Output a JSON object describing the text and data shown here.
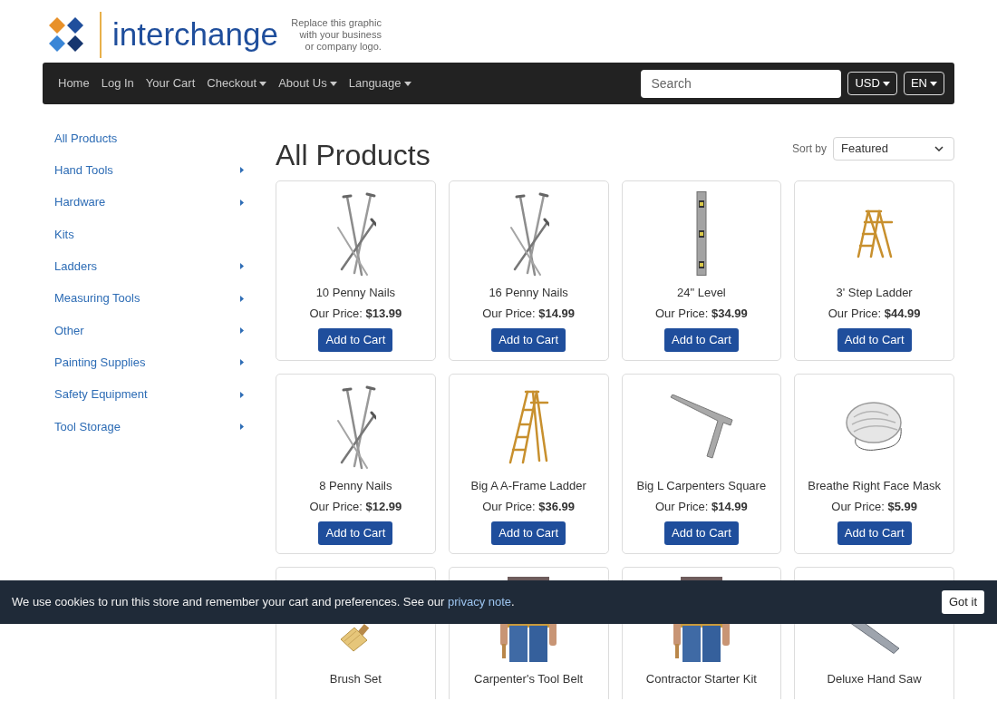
{
  "header": {
    "logo_text": "interchange",
    "tagline": "Replace this graphic with your business or company logo."
  },
  "nav": {
    "links": [
      {
        "label": "Home",
        "dropdown": false
      },
      {
        "label": "Log In",
        "dropdown": false
      },
      {
        "label": "Your Cart",
        "dropdown": false
      },
      {
        "label": "Checkout",
        "dropdown": true
      },
      {
        "label": "About Us",
        "dropdown": true
      },
      {
        "label": "Language",
        "dropdown": true
      }
    ],
    "search": {
      "placeholder": "Search"
    },
    "currency": "USD",
    "language": "EN"
  },
  "sidebar": {
    "items": [
      {
        "label": "All Products",
        "has_submenu": false
      },
      {
        "label": "Hand Tools",
        "has_submenu": true
      },
      {
        "label": "Hardware",
        "has_submenu": true
      },
      {
        "label": "Kits",
        "has_submenu": false
      },
      {
        "label": "Ladders",
        "has_submenu": true
      },
      {
        "label": "Measuring Tools",
        "has_submenu": true
      },
      {
        "label": "Other",
        "has_submenu": true
      },
      {
        "label": "Painting Supplies",
        "has_submenu": true
      },
      {
        "label": "Safety Equipment",
        "has_submenu": true
      },
      {
        "label": "Tool Storage",
        "has_submenu": true
      }
    ]
  },
  "main": {
    "title": "All Products",
    "sort": {
      "label": "Sort by",
      "value": "Featured"
    },
    "products": [
      {
        "kind": "nails",
        "name": "10 Penny Nails",
        "price": "Our Price: **$13.99**",
        "button": "Add to Cart"
      },
      {
        "kind": "nails",
        "name": "16 Penny Nails",
        "price": "Our Price: **$14.99**",
        "button": "Add to Cart"
      },
      {
        "kind": "level",
        "name": "24\" Level",
        "price": "Our Price: **$34.99**",
        "button": "Add to Cart"
      },
      {
        "kind": "step_ladder",
        "name": "3' Step Ladder",
        "price": "Our Price: **$44.99**",
        "button": "Add to Cart"
      },
      {
        "kind": "nails",
        "name": "8 Penny Nails",
        "price": "Our Price: **$12.99**",
        "button": "Add to Cart"
      },
      {
        "kind": "tall_ladder",
        "name": "Big A A-Frame Ladder",
        "price": "Our Price: **$36.99**",
        "button": "Add to Cart"
      },
      {
        "kind": "square",
        "name": "Big L Carpenters Square",
        "price": "Our Price: **$14.99**",
        "button": "Add to Cart"
      },
      {
        "kind": "mask",
        "name": "Breathe Right Face Mask",
        "price": "Our Price: **$5.99**",
        "button": "Add to Cart"
      },
      {
        "kind": "brush",
        "name": "Brush Set"
      },
      {
        "kind": "tool_belt",
        "name": "Carpenter's Tool Belt"
      },
      {
        "kind": "tool_belt",
        "name": "Contractor Starter Kit"
      },
      {
        "kind": "saw",
        "name": "Deluxe Hand Saw"
      }
    ]
  },
  "cookie_banner": {
    "text": "We use cookies to run this store and remember your cart and preferences. See our ",
    "link": "privacy note",
    "text_end": ".",
    "button": "Got it"
  }
}
